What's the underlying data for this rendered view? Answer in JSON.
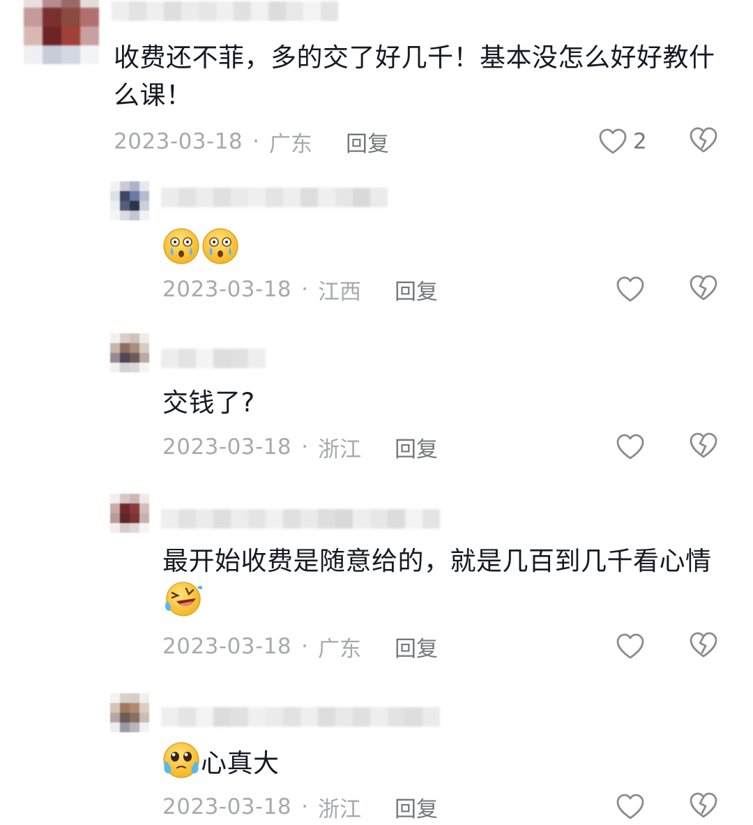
{
  "comments": [
    {
      "text": "收费还不菲，多的交了好几千！基本没怎么好好教什么课！",
      "date": "2023-03-18",
      "location": "广东",
      "reply_label": "回复",
      "like_count": "2"
    }
  ],
  "replies": [
    {
      "emoji": [
        "crying-surprised-emoji",
        "crying-surprised-emoji"
      ],
      "date": "2023-03-18",
      "location": "江西",
      "reply_label": "回复"
    },
    {
      "text": "交钱了?",
      "date": "2023-03-18",
      "location": "浙江",
      "reply_label": "回复"
    },
    {
      "text": "最开始收费是随意给的，就是几百到几千看心情",
      "emoji": [
        "laughing-crying-emoji"
      ],
      "date": "2023-03-18",
      "location": "广东",
      "reply_label": "回复"
    },
    {
      "text": "心真大",
      "emoji": [
        "teary-eyed-emoji"
      ],
      "date": "2023-03-18",
      "location": "浙江",
      "reply_label": "回复"
    }
  ],
  "meta_separator": "·",
  "colors": {
    "text": "#161823",
    "meta": "#a7a9ae",
    "reply": "#75777d",
    "icon": "#8a8b91"
  },
  "icons": [
    "heart-outline-icon",
    "broken-heart-icon"
  ]
}
